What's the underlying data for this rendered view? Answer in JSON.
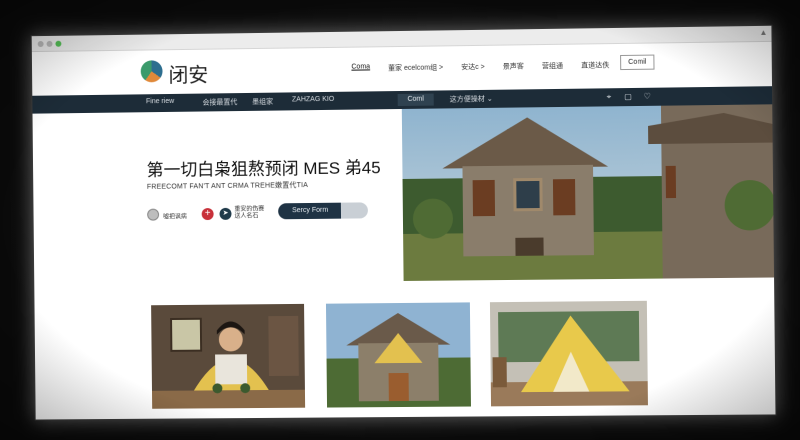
{
  "brand": {
    "name": "闭安",
    "logo_icon": "brand-logo-icon"
  },
  "topnav": {
    "links": [
      "Coma",
      "董家 ecelcom组 >",
      "安达c >",
      "景声客",
      "营组通",
      "直道达佚"
    ],
    "active_index": 0,
    "cta": "Comil"
  },
  "subnav": {
    "items": [
      "Fine riew",
      "会接最置代",
      "墨组家",
      "ZAHZAG KIO"
    ],
    "pill": "Coml",
    "dropdown": "这方便操材 ⌄",
    "icons": [
      "crosshair-icon",
      "chat-icon",
      "heart-icon"
    ]
  },
  "hero": {
    "title": "第一切白枭狙熬预闭 MES 弟45",
    "subtitle": "FREECOMT FAN'T ANT CRMA TREHE嫩置代TIA",
    "profile_name": "嘘把讽病",
    "plus_label": "+",
    "profile2_label_line1": "重安的伤赛",
    "profile2_label_line2": "送人名石",
    "button": "Sercy Form"
  },
  "images": {
    "hero": "stone-cottage-photo",
    "thumbs": [
      "woman-with-blanket-photo",
      "stone-cottage-photo",
      "camping-tent-photo"
    ]
  },
  "colors": {
    "subnav_bg": "#1d2c38",
    "plus_red": "#c8313a",
    "hero_button": "#1f3344"
  }
}
